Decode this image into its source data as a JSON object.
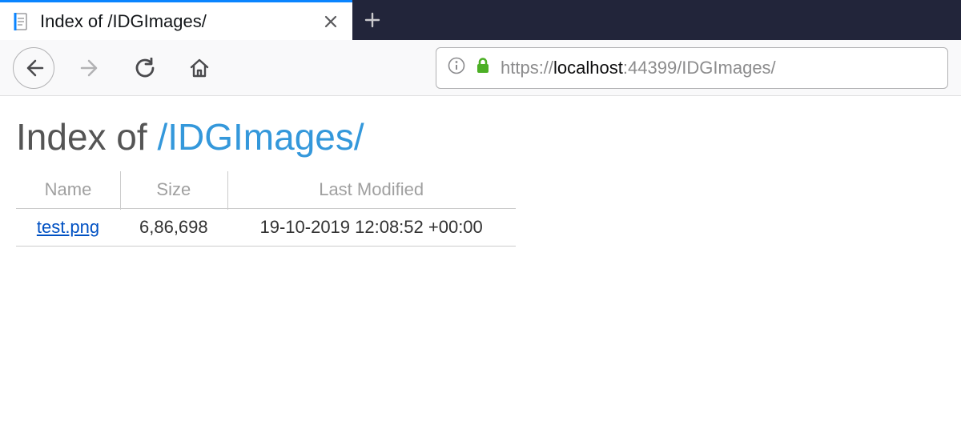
{
  "browser": {
    "tab": {
      "title": "Index of /IDGImages/"
    },
    "url": {
      "scheme": "https://",
      "host": "localhost",
      "port": ":44399",
      "path": "/IDGImages/"
    }
  },
  "page": {
    "heading_prefix": "Index of ",
    "heading_path": "/IDGImages/",
    "columns": {
      "name": "Name",
      "size": "Size",
      "modified": "Last Modified"
    },
    "files": [
      {
        "name": "test.png",
        "size": "6,86,698",
        "modified": "19-10-2019 12:08:52 +00:00"
      }
    ]
  }
}
